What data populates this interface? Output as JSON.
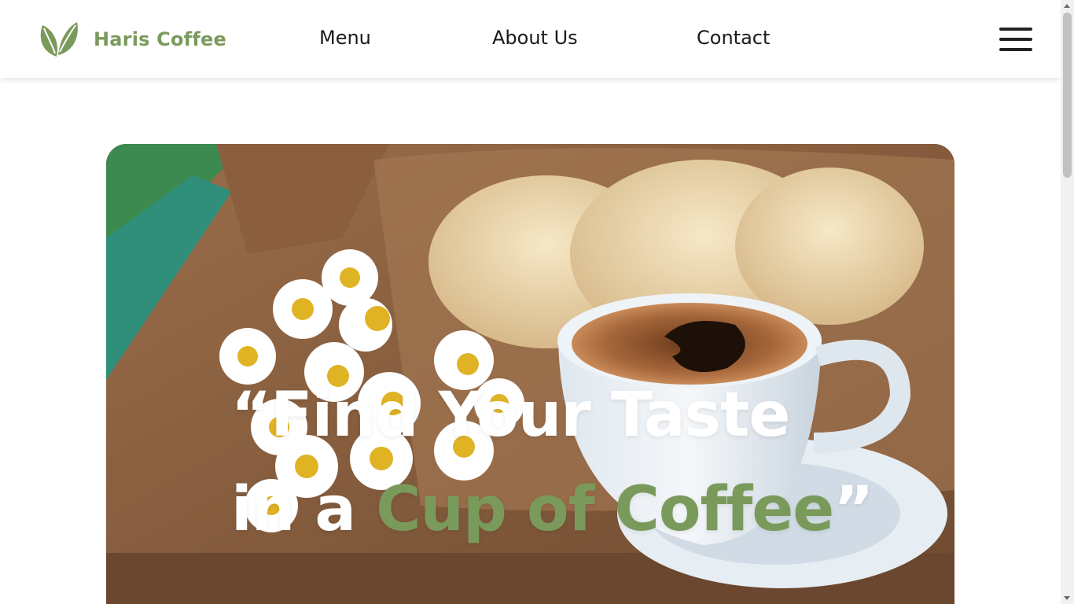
{
  "header": {
    "brand_name": "Haris Coffee",
    "nav": [
      {
        "label": "Menu"
      },
      {
        "label": "About Us"
      },
      {
        "label": "Contact"
      }
    ]
  },
  "hero": {
    "headline_line1": "“Find Your Taste",
    "headline_line2_prefix": "in a ",
    "headline_line2_accent": "Cup of Coffee",
    "headline_line2_suffix": "”"
  },
  "colors": {
    "accent": "#7a9a5c",
    "text": "#1a1a1a",
    "background": "#ffffff"
  },
  "icons": {
    "logo": "leaf-logo-icon",
    "menu": "hamburger-menu-icon"
  }
}
